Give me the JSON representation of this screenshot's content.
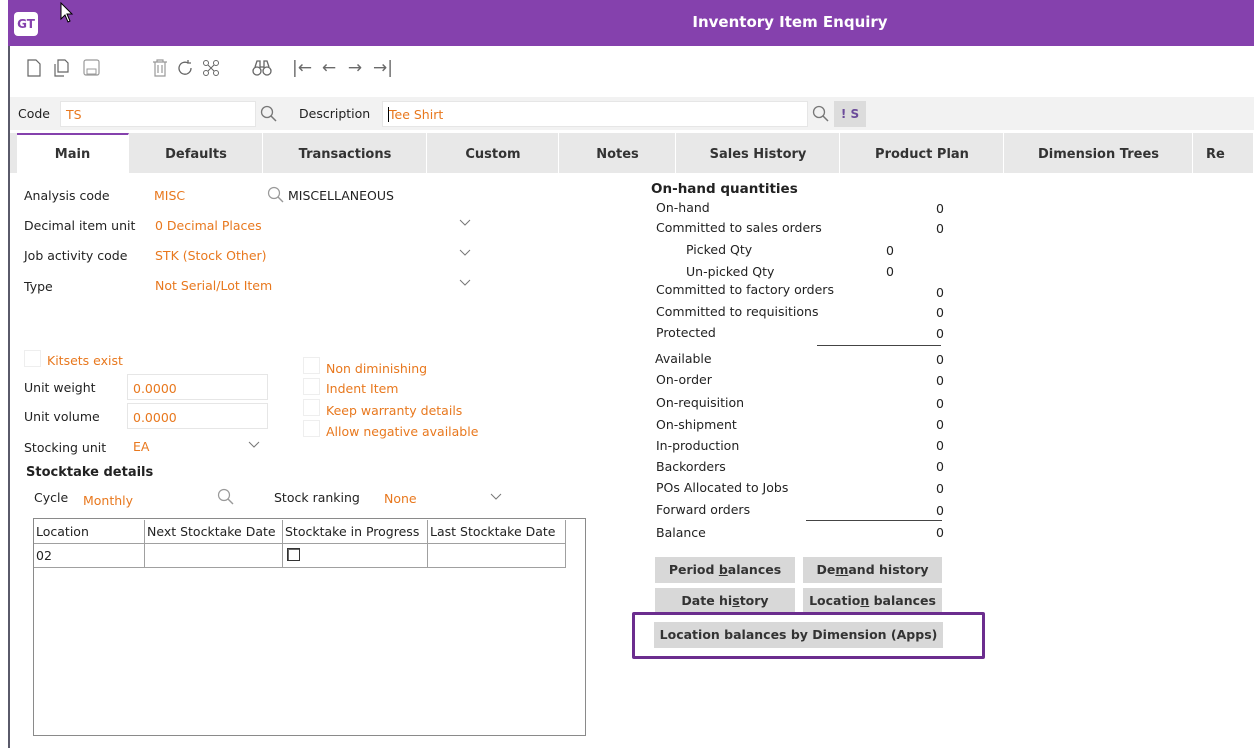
{
  "app": {
    "logo": "GT",
    "title": "Inventory Item Enquiry"
  },
  "toolbar": {
    "icons": [
      "new-document-icon",
      "copy-document-icon",
      "save-icon",
      "delete-icon",
      "refresh-icon",
      "link-icon",
      "find-icon",
      "first-icon",
      "prev-icon",
      "next-icon",
      "last-icon"
    ],
    "first_glyph": "|←",
    "prev_glyph": "←",
    "next_glyph": "→",
    "last_glyph": "→|"
  },
  "header": {
    "code_label": "Code",
    "code_value": "TS",
    "desc_label": "Description",
    "desc_value": "Tee Shirt",
    "flag": "! S"
  },
  "tabs": [
    "Main",
    "Defaults",
    "Transactions",
    "Custom",
    "Notes",
    "Sales History",
    "Product Plan",
    "Dimension Trees",
    "Re"
  ],
  "main": {
    "analysis_label": "Analysis code",
    "analysis_value": "MISC",
    "analysis_desc": "MISCELLANEOUS",
    "decimal_label": "Decimal item unit",
    "decimal_value": "0 Decimal Places",
    "job_label": "Job activity code",
    "job_value": "STK (Stock Other)",
    "type_label": "Type",
    "type_value": "Not Serial/Lot Item",
    "kitsets": "Kitsets exist",
    "weight_label": "Unit weight",
    "weight_value": "0.0000",
    "volume_label": "Unit volume",
    "volume_value": "0.0000",
    "stocking_label": "Stocking unit",
    "stocking_value": "EA",
    "non_diminishing": "Non diminishing",
    "indent": "Indent Item",
    "warranty": "Keep warranty details",
    "allow_negative": "Allow negative available",
    "stocktake_title": "Stocktake details",
    "cycle_label": "Cycle",
    "cycle_value": "Monthly",
    "ranking_label": "Stock ranking",
    "ranking_value": "None",
    "grid_headers": [
      "Location",
      "Next Stocktake Date",
      "Stocktake in Progress",
      "Last Stocktake Date"
    ],
    "grid_rows": [
      [
        "02",
        "",
        "",
        ""
      ]
    ]
  },
  "onhand": {
    "title": "On-hand quantities",
    "onhand_label": "On-hand",
    "onhand_value": "0",
    "committed_sales_label": "Committed to sales orders",
    "committed_sales_value": "0",
    "picked_label": "Picked Qty",
    "picked_value": "0",
    "unpicked_label": "Un-picked Qty",
    "unpicked_value": "0",
    "committed_factory_label": "Committed to factory orders",
    "committed_factory_value": "0",
    "committed_req_label": "Committed to requisitions",
    "committed_req_value": "0",
    "protected_label": "Protected",
    "protected_value": "0",
    "available_label": "Available",
    "available_value": "0",
    "onorder_label": "On-order",
    "onorder_value": "0",
    "onreq_label": "On-requisition",
    "onreq_value": "0",
    "onship_label": "On-shipment",
    "onship_value": "0",
    "inprod_label": "In-production",
    "inprod_value": "0",
    "backorders_label": "Backorders",
    "backorders_value": "0",
    "pos_label": "POs Allocated to Jobs",
    "pos_value": "0",
    "forward_label": "Forward orders",
    "forward_value": "0",
    "balance_label": "Balance",
    "balance_value": "0"
  },
  "buttons": {
    "period_pre": "Period ",
    "period_u": "b",
    "period_post": "alances",
    "demand_pre": "De",
    "demand_u": "m",
    "demand_post": "and history",
    "date_pre": "Date hi",
    "date_u": "s",
    "date_post": "tory",
    "location_pre": "Locatio",
    "location_u": "n",
    "location_post": " balances",
    "dimension": "Location balances by Dimension (Apps)"
  },
  "colors": {
    "titlebar": "#8541ad",
    "field_text": "#e8781e",
    "highlight_border": "#6b2d8e"
  }
}
